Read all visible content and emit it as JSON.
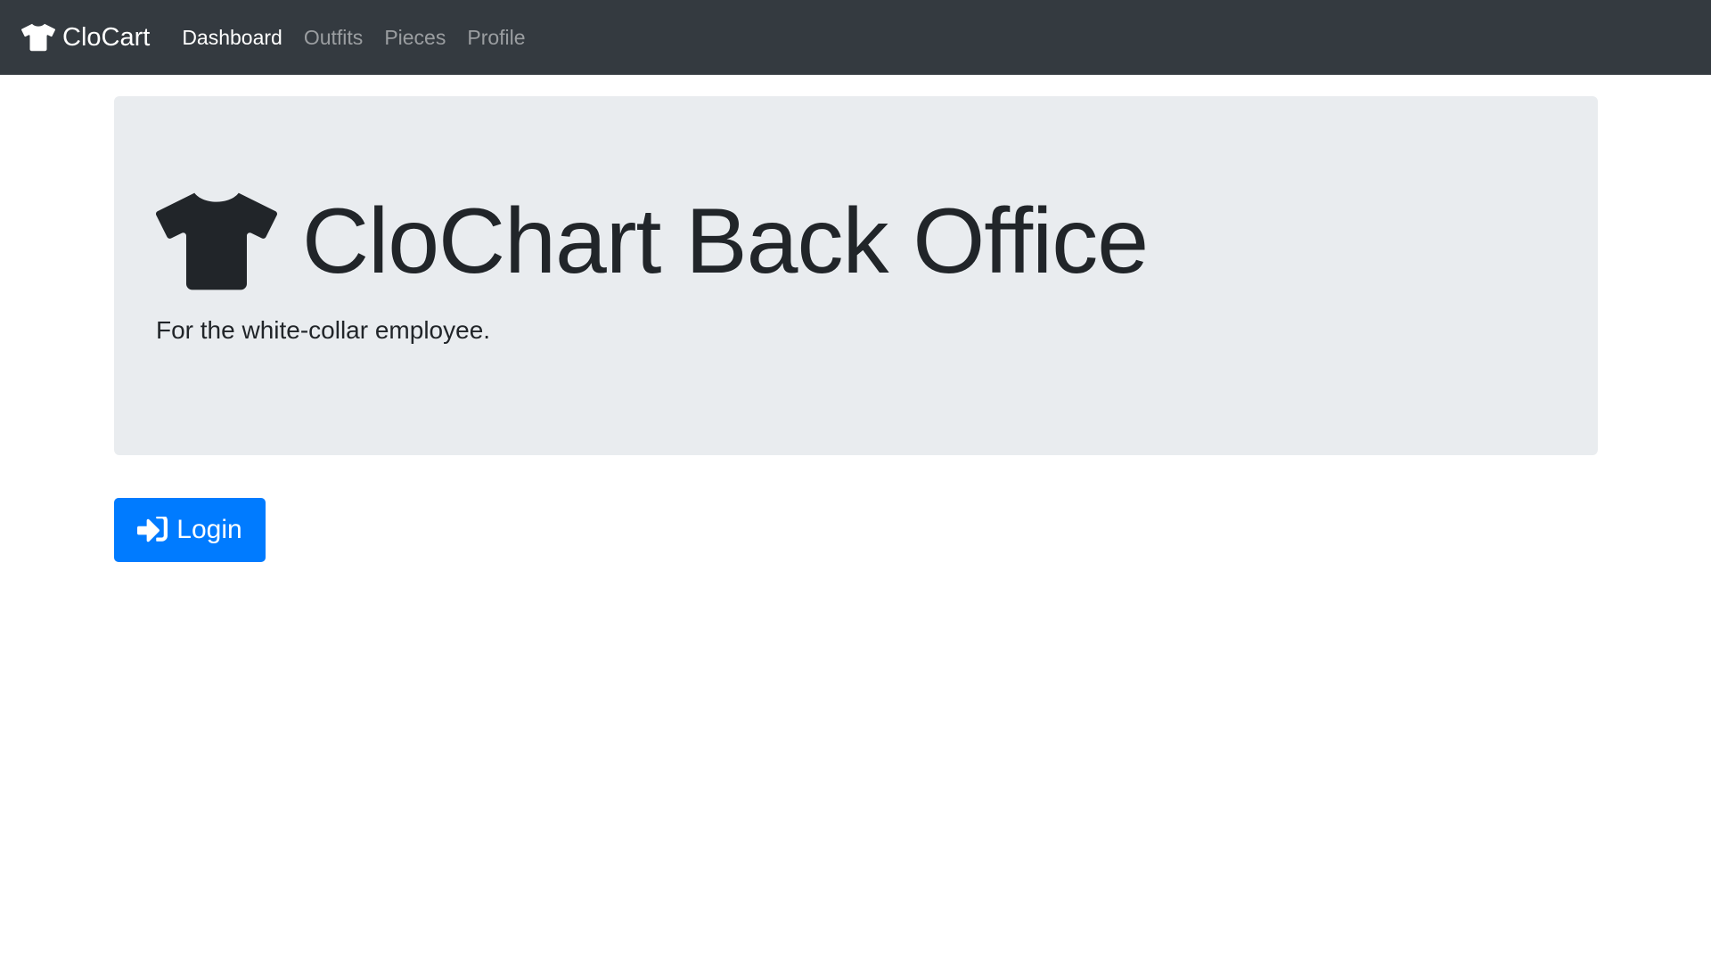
{
  "navbar": {
    "brand": {
      "icon": "tshirt-icon",
      "label": "CloCart"
    },
    "links": [
      {
        "label": "Dashboard",
        "active": true
      },
      {
        "label": "Outfits",
        "active": false
      },
      {
        "label": "Pieces",
        "active": false
      },
      {
        "label": "Profile",
        "active": false
      }
    ]
  },
  "hero": {
    "icon": "tshirt-icon",
    "title": "CloChart Back Office",
    "subtitle": "For the white-collar employee."
  },
  "login_button": {
    "icon": "sign-in-icon",
    "label": "Login"
  },
  "colors": {
    "navbar_bg": "#343a40",
    "jumbotron_bg": "#e9ecef",
    "primary": "#007bff",
    "text_dark": "#212529"
  }
}
